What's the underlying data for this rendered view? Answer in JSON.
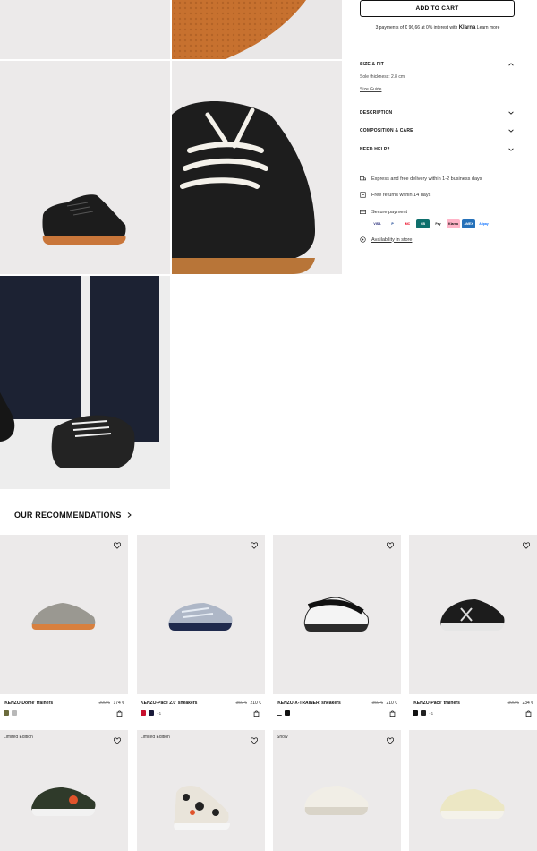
{
  "buy_box": {
    "add_to_cart": "ADD TO CART",
    "klarna_text": "3 payments of € 96,66 at 0% interest with",
    "klarna_brand": "Klarna",
    "learn_more": "Learn more"
  },
  "accordion": {
    "size_fit": "SIZE & FIT",
    "sole_thickness": "Sole thickness: 2.8 cm.",
    "size_guide": "Size Guide",
    "description": "DESCRIPTION",
    "composition": "COMPOSITION & CARE",
    "need_help": "NEED HELP?"
  },
  "services": {
    "delivery": "Express and free delivery within 1-2 business days",
    "returns": "Free returns within 14 days",
    "secure": "Secure payment",
    "availability": "Availability in store"
  },
  "payment_methods": [
    "VISA",
    "P",
    "MC",
    "CB",
    "Pay",
    "Klarna",
    "AMEX",
    "Alipay"
  ],
  "recommendations": {
    "title": "OUR RECOMMENDATIONS",
    "products": [
      {
        "name": "'KENZO-Dome' trainers",
        "old_price": "290 €",
        "price": "174 €",
        "swatches": [
          "#6b6b3c",
          "#b8b8b8"
        ],
        "more": ""
      },
      {
        "name": "KENZO-Pace 2.0' sneakers",
        "old_price": "350 €",
        "price": "210 €",
        "swatches": [
          "#c8102e",
          "#1a1a3a"
        ],
        "more": "+1"
      },
      {
        "name": "'KENZO-X-TRAINER' sneakers",
        "old_price": "350 €",
        "price": "210 €",
        "swatches": [
          "#ffffff",
          "#111111"
        ],
        "more": ""
      },
      {
        "name": "'KENZO-Pace' trainers",
        "old_price": "390 €",
        "price": "234 €",
        "swatches": [
          "#111111",
          "#222222"
        ],
        "more": "+1"
      }
    ],
    "row2_tags": [
      "Limited Edition",
      "Limited Edition",
      "Show",
      ""
    ]
  }
}
